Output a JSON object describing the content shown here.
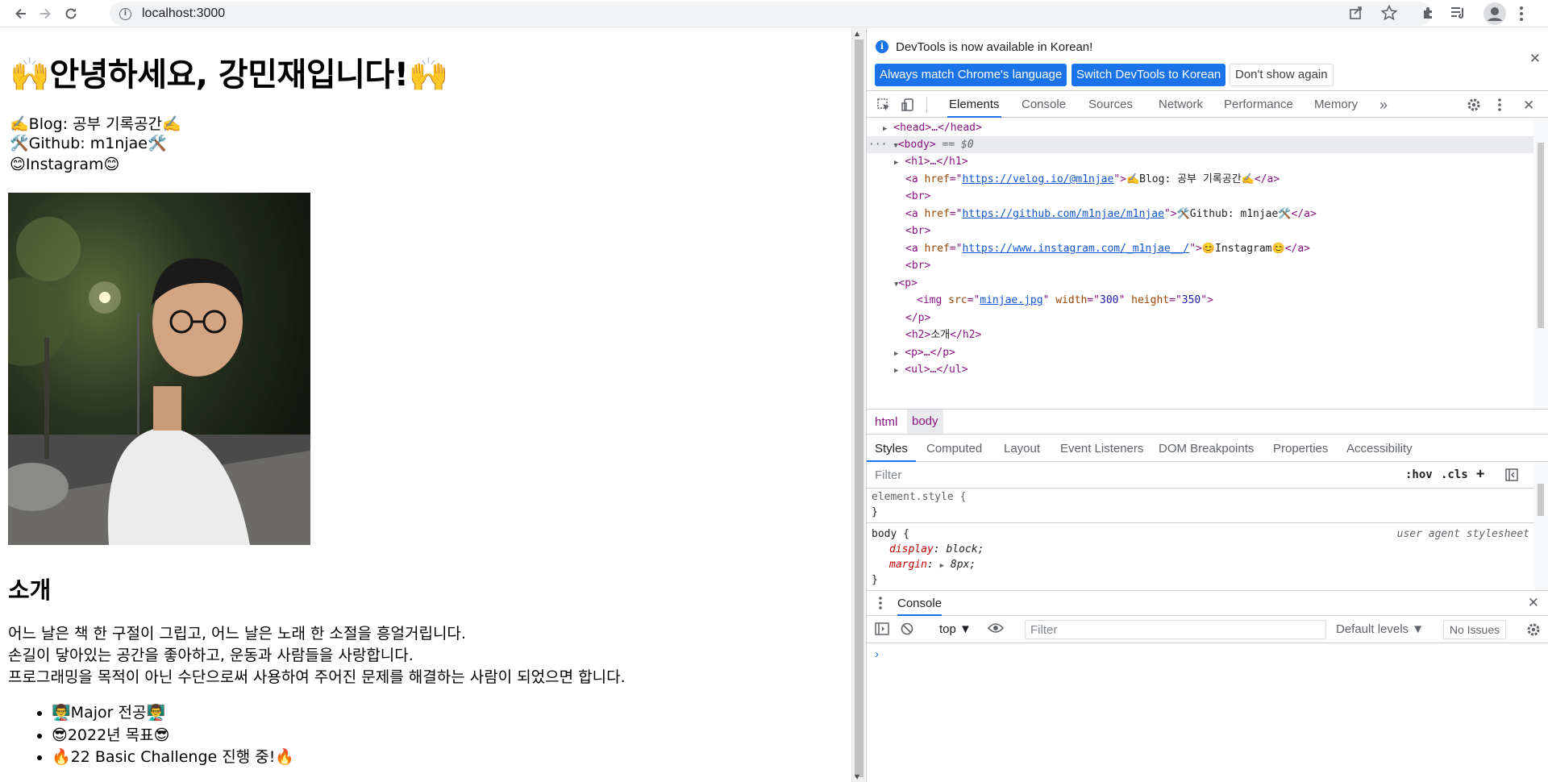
{
  "browser": {
    "url": "localhost:3000",
    "icons": [
      "back-arrow-icon",
      "forward-arrow-icon",
      "reload-icon",
      "info-icon",
      "share-icon",
      "bookmark-star-icon",
      "extensions-icon",
      "reading-list-icon",
      "profile-icon",
      "menu-kebab-icon"
    ]
  },
  "page": {
    "title_emoji": "🙌",
    "title": "안녕하세요, 강민재입니다!",
    "links": [
      {
        "pre": "✍️",
        "label": "Blog: 공부 기록공간",
        "post": "✍️"
      },
      {
        "pre": "🛠️",
        "label": "Github: m1njae",
        "post": "🛠️"
      },
      {
        "pre": "😊",
        "label": "Instagram",
        "post": "😊"
      }
    ],
    "intro_heading": "소개",
    "intro_lines": [
      "어느 날은 책 한 구절이 그립고, 어느 날은 노래 한 소절을 흥얼거립니다.",
      "손길이 닿아있는 공간을 좋아하고, 운동과 사람들을 사랑합니다.",
      "프로그래밍을 목적이 아닌 수단으로써 사용하여 주어진 문제를 해결하는 사람이 되었으면 합니다."
    ],
    "list_items": [
      {
        "pre": "👨‍🏫",
        "label": "Major 전공",
        "post": "👨‍🏫"
      },
      {
        "pre": "😎",
        "label": "2022년 목표",
        "post": "😎"
      },
      {
        "pre": "🔥",
        "label": "22 Basic Challenge 진행 중!",
        "post": "🔥"
      }
    ]
  },
  "devtools": {
    "infobar": {
      "message": "DevTools is now available in Korean!",
      "btn_match": "Always match Chrome's language",
      "btn_switch": "Switch DevTools to Korean",
      "btn_dismiss": "Don't show again"
    },
    "tabs": [
      "Elements",
      "Console",
      "Sources",
      "Network",
      "Performance",
      "Memory"
    ],
    "active_tab": "Elements",
    "more_tabs": "»",
    "dom": {
      "head": "<head>…</head>",
      "body": "<body>",
      "body_marker": "== $0",
      "h1": "<h1>…</h1>",
      "a_open": "<a",
      "href": "href",
      "blog_url": "https://velog.io/@m1njae",
      "blog_text": "✍️Blog: 공부 기록공간✍️",
      "github_url": "https://github.com/m1njae/m1njae",
      "github_text": "🛠️Github: m1njae🛠️",
      "insta_url": "https://www.instagram.com/_m1njae__/",
      "insta_text": "😊Instagram😊",
      "a_close": "</a>",
      "br": "<br>",
      "p_open": "<p>",
      "img_open": "<img",
      "src_attr": "src",
      "src_val": "minjae.jpg",
      "width_attr": "width",
      "width_val": "300",
      "height_attr": "height",
      "height_val": "350",
      "p_close": "</p>",
      "h2_open": "<h2>",
      "h2_text": "소개",
      "h2_close": "</h2>",
      "p_collapsed": "<p>…</p>",
      "ul_collapsed": "<ul>…</ul>"
    },
    "breadcrumbs": [
      "html",
      "body"
    ],
    "style_tabs": [
      "Styles",
      "Computed",
      "Layout",
      "Event Listeners",
      "DOM Breakpoints",
      "Properties",
      "Accessibility"
    ],
    "style_filter_placeholder": "Filter",
    "hov": ":hov",
    "cls": ".cls",
    "styles": {
      "element_style": "element.style {",
      "close_brace": "}",
      "body_sel": "body {",
      "ua": "user agent stylesheet",
      "prop1_name": "display",
      "prop1_val": "block;",
      "prop2_name": "margin",
      "prop2_val": "8px;"
    },
    "console": {
      "tab": "Console",
      "context": "top ▼",
      "filter_placeholder": "Filter",
      "levels": "Default levels ▼",
      "issues": "No Issues",
      "prompt": "›"
    },
    "accent": "#1a73e8"
  }
}
